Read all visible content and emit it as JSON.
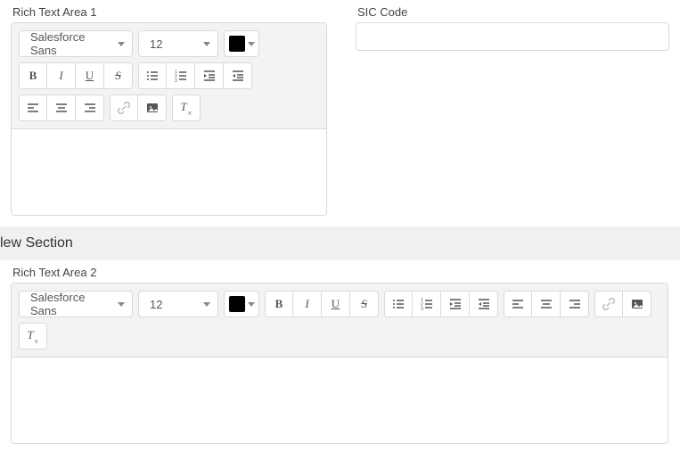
{
  "fields": {
    "rta1_label": "Rich Text Area 1",
    "rta2_label": "Rich Text Area 2",
    "sic_label": "SIC Code",
    "sic_value": ""
  },
  "section": {
    "title": "lew Section"
  },
  "rte": {
    "font": "Salesforce Sans",
    "size": "12",
    "color": "#000000",
    "buttons": {
      "bold": "B",
      "italic": "I",
      "underline": "U",
      "strike": "S"
    }
  }
}
